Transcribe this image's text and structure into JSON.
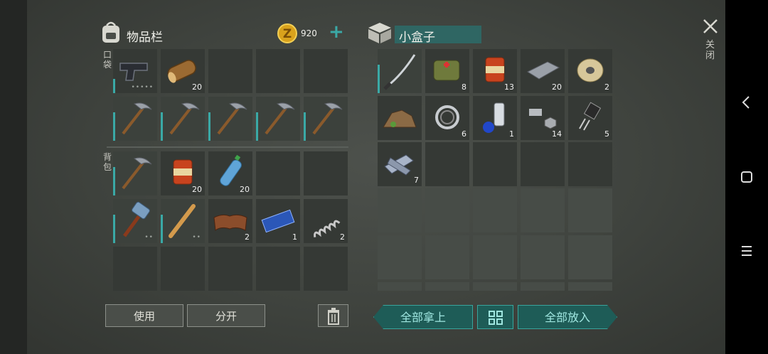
{
  "inventory": {
    "title": "物品栏",
    "coins": "920",
    "plus": "+",
    "pocket_label": "口袋",
    "backpack_label": "背包",
    "pocket_slots": [
      {
        "item": "pistol-icon",
        "count": "",
        "dots": "•••••"
      },
      {
        "item": "log-icon",
        "count": "20",
        "dots": ""
      },
      {
        "item": "",
        "count": "",
        "dots": ""
      },
      {
        "item": "",
        "count": "",
        "dots": ""
      },
      {
        "item": "",
        "count": "",
        "dots": ""
      }
    ],
    "tool_slots": [
      {
        "item": "pickaxe-icon",
        "count": ""
      },
      {
        "item": "pickaxe-icon",
        "count": ""
      },
      {
        "item": "pickaxe-icon",
        "count": ""
      },
      {
        "item": "pickaxe-icon",
        "count": ""
      },
      {
        "item": "pickaxe-icon",
        "count": ""
      }
    ],
    "backpack_slots": [
      {
        "item": "pickaxe-icon",
        "count": "",
        "dots": ""
      },
      {
        "item": "canned-food-icon",
        "count": "20",
        "dots": ""
      },
      {
        "item": "water-bottle-icon",
        "count": "20",
        "dots": ""
      },
      {
        "item": "",
        "count": "",
        "dots": ""
      },
      {
        "item": "",
        "count": "",
        "dots": ""
      },
      {
        "item": "sledgehammer-icon",
        "count": "",
        "dots": "••"
      },
      {
        "item": "baseball-bat-icon",
        "count": "",
        "dots": "••"
      },
      {
        "item": "leather-icon",
        "count": "2",
        "dots": ""
      },
      {
        "item": "circuit-board-icon",
        "count": "1",
        "dots": ""
      },
      {
        "item": "spring-icon",
        "count": "2",
        "dots": ""
      }
    ],
    "use_label": "使用",
    "split_label": "分开"
  },
  "box": {
    "title": "小盒子",
    "slots": [
      {
        "item": "katana-icon",
        "count": ""
      },
      {
        "item": "first-aid-bag-icon",
        "count": "8"
      },
      {
        "item": "canned-food-icon",
        "count": "13"
      },
      {
        "item": "iron-bar-icon",
        "count": "20"
      },
      {
        "item": "wire-spool-icon",
        "count": "2"
      },
      {
        "item": "scrap-pile-icon",
        "count": ""
      },
      {
        "item": "bearing-icon",
        "count": "6"
      },
      {
        "item": "spray-can-icon",
        "count": "1"
      },
      {
        "item": "bolt-nut-icon",
        "count": "14"
      },
      {
        "item": "transistor-icon",
        "count": "5"
      },
      {
        "item": "metal-plates-icon",
        "count": "7"
      }
    ],
    "take_all_label": "全部拿上",
    "put_all_label": "全部放入"
  },
  "close_label": "关闭",
  "accent": "#3aa9a6"
}
